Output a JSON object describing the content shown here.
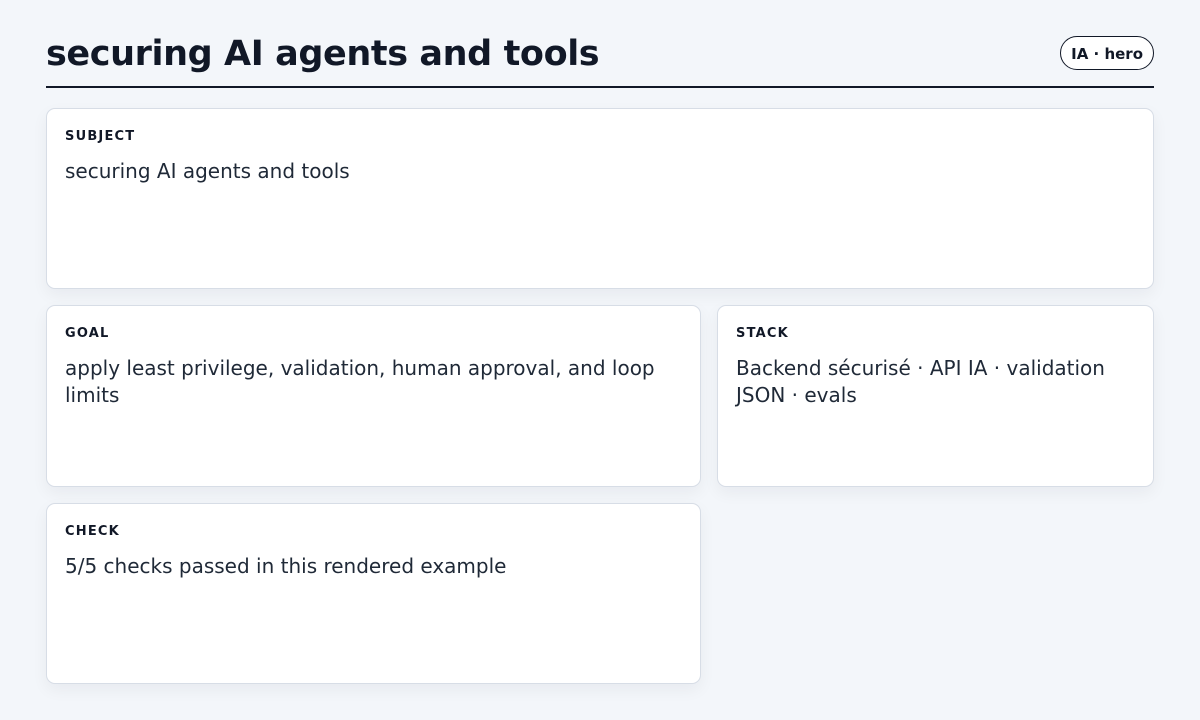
{
  "header": {
    "title": "securing AI agents and tools",
    "badge": "IA · hero"
  },
  "cards": {
    "subject": {
      "label": "SUBJECT",
      "value": "securing AI agents and tools"
    },
    "goal": {
      "label": "GOAL",
      "value": "apply least privilege, validation, human approval, and loop limits"
    },
    "stack": {
      "label": "STACK",
      "value": "Backend sécurisé · API IA · validation JSON · evals"
    },
    "check": {
      "label": "CHECK",
      "value": "5/5 checks passed in this rendered example"
    }
  }
}
